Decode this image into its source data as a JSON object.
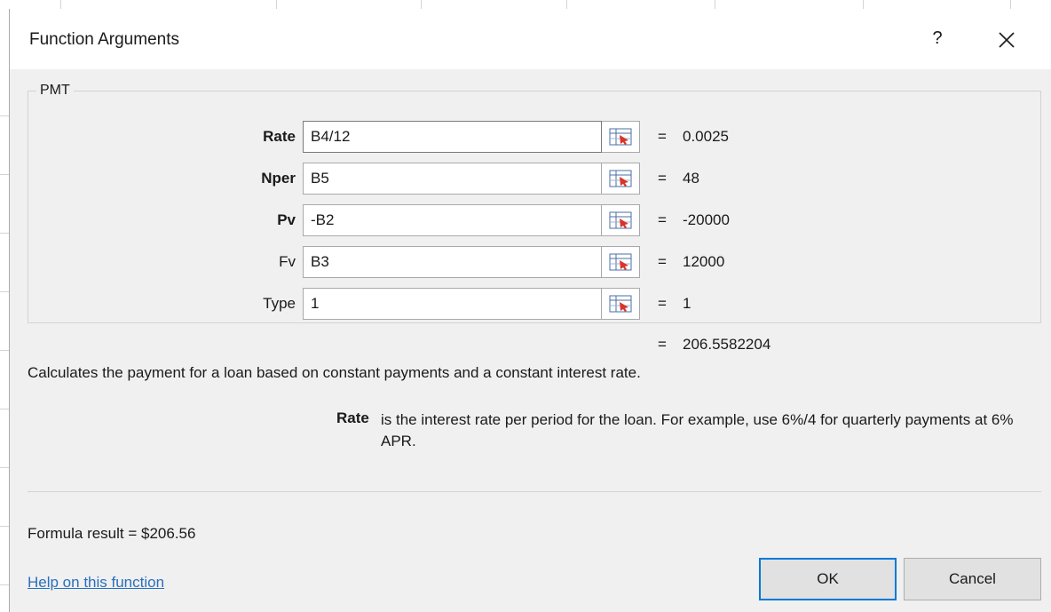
{
  "dialog": {
    "title": "Function Arguments",
    "help_button": "?",
    "close_icon": "close-icon"
  },
  "function": {
    "name": "PMT",
    "arguments": [
      {
        "label": "Rate",
        "value": "B4/12",
        "result": "0.0025",
        "bold": true
      },
      {
        "label": "Nper",
        "value": "B5",
        "result": "48",
        "bold": true
      },
      {
        "label": "Pv",
        "value": "-B2",
        "result": "-20000",
        "bold": true
      },
      {
        "label": "Fv",
        "value": "B3",
        "result": "12000",
        "bold": false
      },
      {
        "label": "Type",
        "value": "1",
        "result": "1",
        "bold": false
      }
    ],
    "equals_sign": "=",
    "result": "206.5582204",
    "description": "Calculates the payment for a loan based on constant payments and a constant interest rate.",
    "arg_help": {
      "name": "Rate",
      "text": "is the interest rate per period for the loan. For example, use 6%/4 for quarterly payments at 6% APR."
    }
  },
  "footer": {
    "formula_result": "Formula result =   $206.56",
    "help_link": "Help on this function",
    "ok_label": "OK",
    "cancel_label": "Cancel"
  },
  "colors": {
    "ok_border": "#0078d7",
    "link": "#2a6fbe",
    "dialog_bg": "#f0f0f0"
  },
  "icons": {
    "ref_button_icon": "collapse-dialog-icon"
  }
}
